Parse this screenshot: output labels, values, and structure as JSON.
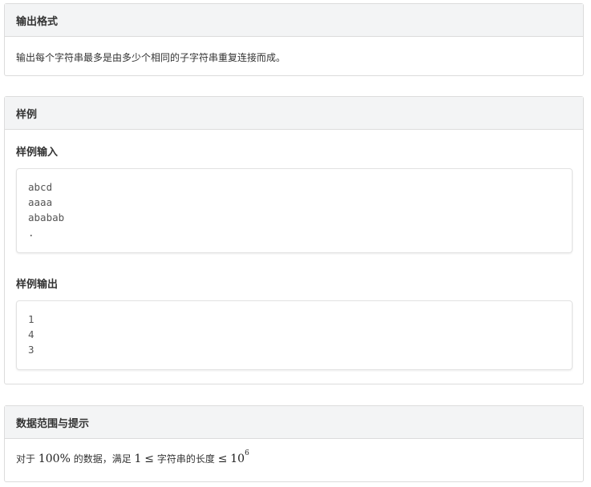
{
  "output_format": {
    "title": "输出格式",
    "description": "输出每个字符串最多是由多少个相同的子字符串重复连接而成。"
  },
  "sample": {
    "title": "样例",
    "input_label": "样例输入",
    "input_lines": [
      "abcd",
      "aaaa",
      "ababab",
      "."
    ],
    "output_label": "样例输出",
    "output_lines": [
      "1",
      "4",
      "3"
    ]
  },
  "constraints": {
    "title": "数据范围与提示",
    "text_prefix": "对于",
    "percent": "100%",
    "text_mid": "的数据，满足",
    "math_one": "1",
    "leq_1": "≤",
    "text_var": "字符串的长度",
    "leq_2": "≤",
    "math_base": "10",
    "math_exp": "6"
  }
}
